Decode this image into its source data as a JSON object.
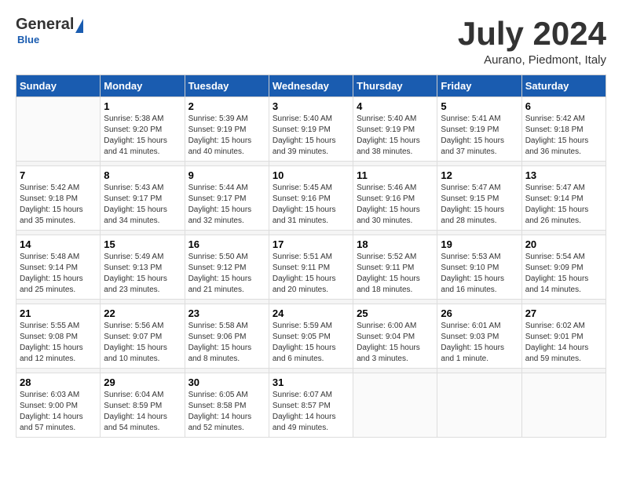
{
  "header": {
    "logo_general": "General",
    "logo_blue": "Blue",
    "month_year": "July 2024",
    "location": "Aurano, Piedmont, Italy"
  },
  "calendar": {
    "days_of_week": [
      "Sunday",
      "Monday",
      "Tuesday",
      "Wednesday",
      "Thursday",
      "Friday",
      "Saturday"
    ],
    "weeks": [
      {
        "days": [
          {
            "num": "",
            "info": ""
          },
          {
            "num": "1",
            "info": "Sunrise: 5:38 AM\nSunset: 9:20 PM\nDaylight: 15 hours\nand 41 minutes."
          },
          {
            "num": "2",
            "info": "Sunrise: 5:39 AM\nSunset: 9:19 PM\nDaylight: 15 hours\nand 40 minutes."
          },
          {
            "num": "3",
            "info": "Sunrise: 5:40 AM\nSunset: 9:19 PM\nDaylight: 15 hours\nand 39 minutes."
          },
          {
            "num": "4",
            "info": "Sunrise: 5:40 AM\nSunset: 9:19 PM\nDaylight: 15 hours\nand 38 minutes."
          },
          {
            "num": "5",
            "info": "Sunrise: 5:41 AM\nSunset: 9:19 PM\nDaylight: 15 hours\nand 37 minutes."
          },
          {
            "num": "6",
            "info": "Sunrise: 5:42 AM\nSunset: 9:18 PM\nDaylight: 15 hours\nand 36 minutes."
          }
        ]
      },
      {
        "days": [
          {
            "num": "7",
            "info": "Sunrise: 5:42 AM\nSunset: 9:18 PM\nDaylight: 15 hours\nand 35 minutes."
          },
          {
            "num": "8",
            "info": "Sunrise: 5:43 AM\nSunset: 9:17 PM\nDaylight: 15 hours\nand 34 minutes."
          },
          {
            "num": "9",
            "info": "Sunrise: 5:44 AM\nSunset: 9:17 PM\nDaylight: 15 hours\nand 32 minutes."
          },
          {
            "num": "10",
            "info": "Sunrise: 5:45 AM\nSunset: 9:16 PM\nDaylight: 15 hours\nand 31 minutes."
          },
          {
            "num": "11",
            "info": "Sunrise: 5:46 AM\nSunset: 9:16 PM\nDaylight: 15 hours\nand 30 minutes."
          },
          {
            "num": "12",
            "info": "Sunrise: 5:47 AM\nSunset: 9:15 PM\nDaylight: 15 hours\nand 28 minutes."
          },
          {
            "num": "13",
            "info": "Sunrise: 5:47 AM\nSunset: 9:14 PM\nDaylight: 15 hours\nand 26 minutes."
          }
        ]
      },
      {
        "days": [
          {
            "num": "14",
            "info": "Sunrise: 5:48 AM\nSunset: 9:14 PM\nDaylight: 15 hours\nand 25 minutes."
          },
          {
            "num": "15",
            "info": "Sunrise: 5:49 AM\nSunset: 9:13 PM\nDaylight: 15 hours\nand 23 minutes."
          },
          {
            "num": "16",
            "info": "Sunrise: 5:50 AM\nSunset: 9:12 PM\nDaylight: 15 hours\nand 21 minutes."
          },
          {
            "num": "17",
            "info": "Sunrise: 5:51 AM\nSunset: 9:11 PM\nDaylight: 15 hours\nand 20 minutes."
          },
          {
            "num": "18",
            "info": "Sunrise: 5:52 AM\nSunset: 9:11 PM\nDaylight: 15 hours\nand 18 minutes."
          },
          {
            "num": "19",
            "info": "Sunrise: 5:53 AM\nSunset: 9:10 PM\nDaylight: 15 hours\nand 16 minutes."
          },
          {
            "num": "20",
            "info": "Sunrise: 5:54 AM\nSunset: 9:09 PM\nDaylight: 15 hours\nand 14 minutes."
          }
        ]
      },
      {
        "days": [
          {
            "num": "21",
            "info": "Sunrise: 5:55 AM\nSunset: 9:08 PM\nDaylight: 15 hours\nand 12 minutes."
          },
          {
            "num": "22",
            "info": "Sunrise: 5:56 AM\nSunset: 9:07 PM\nDaylight: 15 hours\nand 10 minutes."
          },
          {
            "num": "23",
            "info": "Sunrise: 5:58 AM\nSunset: 9:06 PM\nDaylight: 15 hours\nand 8 minutes."
          },
          {
            "num": "24",
            "info": "Sunrise: 5:59 AM\nSunset: 9:05 PM\nDaylight: 15 hours\nand 6 minutes."
          },
          {
            "num": "25",
            "info": "Sunrise: 6:00 AM\nSunset: 9:04 PM\nDaylight: 15 hours\nand 3 minutes."
          },
          {
            "num": "26",
            "info": "Sunrise: 6:01 AM\nSunset: 9:03 PM\nDaylight: 15 hours\nand 1 minute."
          },
          {
            "num": "27",
            "info": "Sunrise: 6:02 AM\nSunset: 9:01 PM\nDaylight: 14 hours\nand 59 minutes."
          }
        ]
      },
      {
        "days": [
          {
            "num": "28",
            "info": "Sunrise: 6:03 AM\nSunset: 9:00 PM\nDaylight: 14 hours\nand 57 minutes."
          },
          {
            "num": "29",
            "info": "Sunrise: 6:04 AM\nSunset: 8:59 PM\nDaylight: 14 hours\nand 54 minutes."
          },
          {
            "num": "30",
            "info": "Sunrise: 6:05 AM\nSunset: 8:58 PM\nDaylight: 14 hours\nand 52 minutes."
          },
          {
            "num": "31",
            "info": "Sunrise: 6:07 AM\nSunset: 8:57 PM\nDaylight: 14 hours\nand 49 minutes."
          },
          {
            "num": "",
            "info": ""
          },
          {
            "num": "",
            "info": ""
          },
          {
            "num": "",
            "info": ""
          }
        ]
      }
    ]
  }
}
